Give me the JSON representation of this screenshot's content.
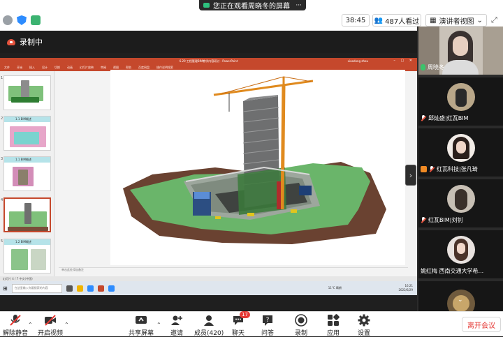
{
  "top": {
    "share_banner": "您正在观看周晓冬的屏幕",
    "timer": "38:45",
    "viewers": "487人看过",
    "view_mode": "演讲者视图"
  },
  "recording": {
    "label": "录制中"
  },
  "ppt": {
    "title": "6.29 工程管理BIM教学内容研讨 - PowerPoint",
    "user": "xiaodong zhou",
    "ribbon_tabs": [
      "文件",
      "开始",
      "插入",
      "设计",
      "切换",
      "动画",
      "幻灯片放映",
      "审阅",
      "视图",
      "帮助",
      "百度网盘",
      "操作说明搜索"
    ],
    "thumbs": [
      {
        "number": "1",
        "title": ""
      },
      {
        "number": "2",
        "title": "1.1 BIM概述"
      },
      {
        "number": "3",
        "title": "1.1 BIM概述"
      },
      {
        "number": "4",
        "title": ""
      },
      {
        "number": "5",
        "title": "1.2 BIM概述"
      }
    ],
    "notes": "单击此处添加备注",
    "status": "幻灯片 4 / 7  中文(中国)",
    "taskbar_search": "在这里输入你要搜索的内容",
    "tray_time": "16:21",
    "tray_date": "2022/6/29",
    "temperature": "11°C 晴朗"
  },
  "gallery": {
    "participants": [
      {
        "name": "周晓冬",
        "muted": false
      },
      {
        "name": "邱灿盛|红瓦BIM",
        "muted": true
      },
      {
        "name": "红瓦科技|张凡琦",
        "muted": true
      },
      {
        "name": "红瓦BIM|刘钊",
        "muted": true
      },
      {
        "name": "姚红梅  西南交通大学希...",
        "muted": true
      },
      {
        "name": "",
        "muted": true
      }
    ]
  },
  "toolbar": {
    "unmute": "解除静音",
    "video": "开启视频",
    "share": "共享屏幕",
    "invite": "邀请",
    "participants": "成员(420)",
    "chat": "聊天",
    "chat_badge": "17",
    "qa": "问答",
    "record": "录制",
    "apps": "应用",
    "settings": "设置",
    "leave": "离开会议"
  },
  "colors": {
    "ppt_accent": "#c5482c",
    "leave_red": "#e53935",
    "unmuted_green": "#3cc36b",
    "zoom_blue": "#2d8cff"
  }
}
